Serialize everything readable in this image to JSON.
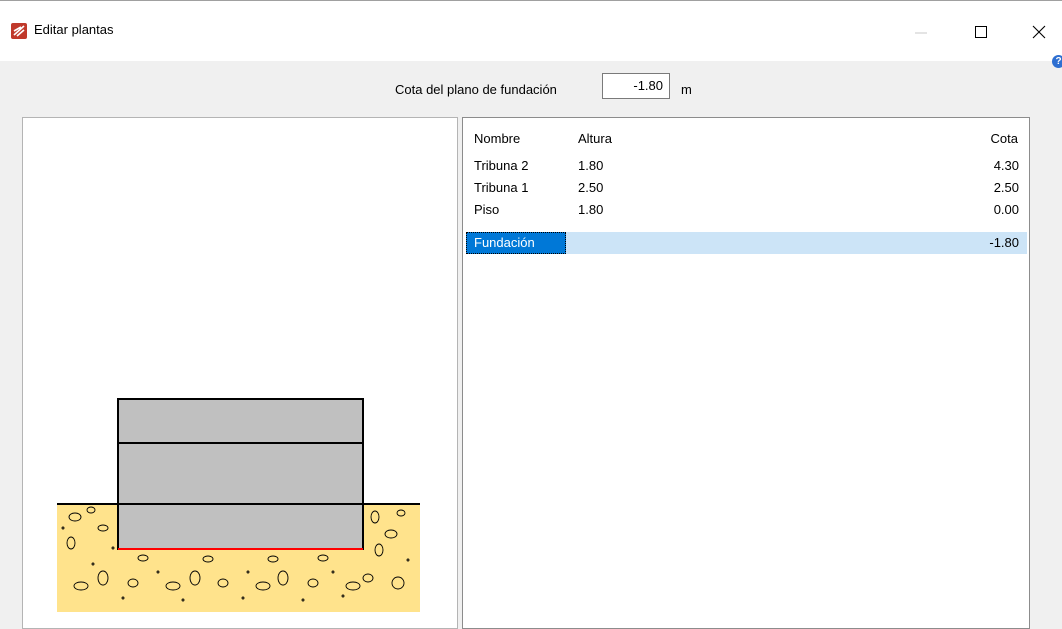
{
  "window": {
    "title": "Editar plantas"
  },
  "foundation": {
    "label": "Cota del plano de fundación",
    "value": "-1.80",
    "unit": "m"
  },
  "table": {
    "headers": {
      "name": "Nombre",
      "height": "Altura",
      "cota": "Cota"
    },
    "rows": [
      {
        "name": "Tribuna 2",
        "height": "1.80",
        "cota": "4.30"
      },
      {
        "name": "Tribuna 1",
        "height": "2.50",
        "cota": "2.50"
      },
      {
        "name": "Piso",
        "height": "1.80",
        "cota": "0.00"
      },
      {
        "name": "Fundación",
        "height": "",
        "cota": "-1.80",
        "selected": true
      }
    ]
  },
  "colors": {
    "selection": "#0078d7",
    "soil": "#ffe38c",
    "building": "#c0c0c0",
    "foundation_line": "#ff0000"
  },
  "icons": [
    "app-icon",
    "minimize-icon",
    "maximize-icon",
    "close-icon",
    "help-icon"
  ]
}
